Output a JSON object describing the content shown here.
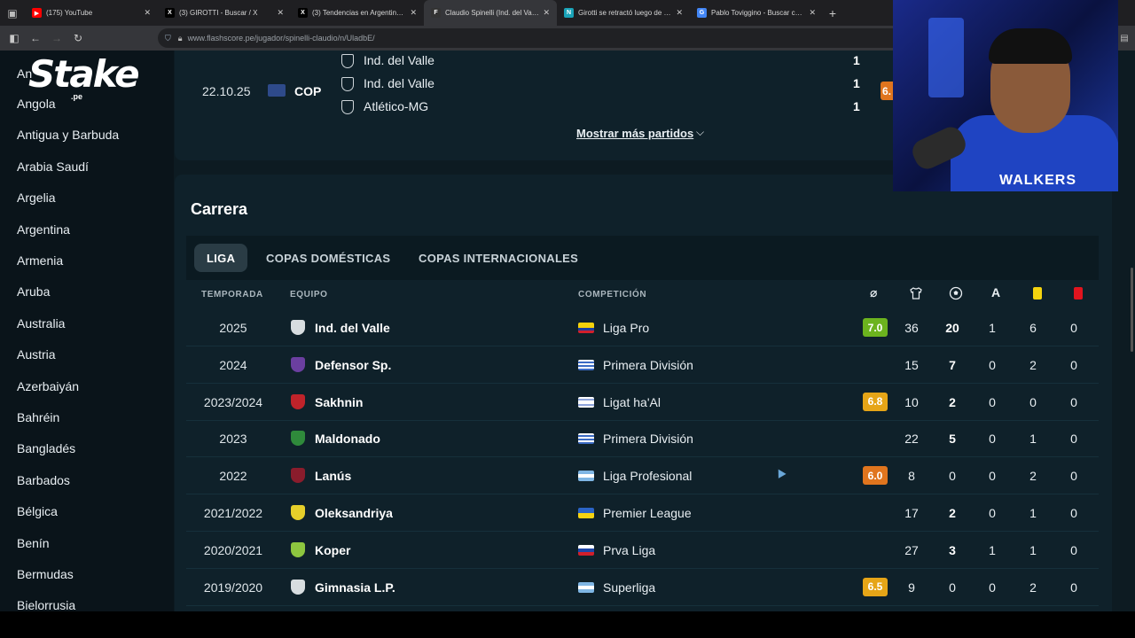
{
  "browser": {
    "tabs": [
      {
        "label": "(175) YouTube",
        "fav_color": "#ff0000",
        "fav_glyph": "▶",
        "active": false
      },
      {
        "label": "(3) GIROTTI - Buscar / X",
        "fav_color": "#000000",
        "fav_glyph": "X",
        "active": false
      },
      {
        "label": "(3) Tendencias en Argentina en",
        "fav_color": "#000000",
        "fav_glyph": "X",
        "active": false
      },
      {
        "label": "Claudio Spinelli (Ind. del Valle) E",
        "fav_color": "#333333",
        "fav_glyph": "F",
        "active": true
      },
      {
        "label": "Girotti se retractó luego de sus",
        "fav_color": "#1aa3b8",
        "fav_glyph": "N",
        "active": false
      },
      {
        "label": "Pablo Toviggino - Buscar con G",
        "fav_color": "#4285f4",
        "fav_glyph": "G",
        "active": false
      }
    ],
    "url": "www.flashscore.pe/jugador/spinelli-claudio/n/UladbE/"
  },
  "sidebar": {
    "countries": [
      "Angola",
      "Antigua y Barbuda",
      "Arabia Saudí",
      "Argelia",
      "Argentina",
      "Armenia",
      "Aruba",
      "Australia",
      "Austria",
      "Azerbaiyán",
      "Bahréin",
      "Bangladés",
      "Barbados",
      "Bélgica",
      "Benín",
      "Bermudas",
      "Bielorrusia"
    ],
    "partial_top": "An",
    "logo_text": "Stake",
    "logo_sub": ".pe"
  },
  "matches": {
    "team_rows": [
      {
        "team": "Ind. del Valle",
        "score": "1"
      },
      {
        "team": "Ind. del Valle",
        "score": "1"
      },
      {
        "team": "Atlético-MG",
        "score": "1"
      }
    ],
    "date": "22.10.25",
    "competition": "COP",
    "rating": "6.",
    "rating_color": "#e0751e",
    "more_label": "Mostrar más partidos"
  },
  "career": {
    "title": "Carrera",
    "tabs": [
      "LIGA",
      "COPAS DOMÉSTICAS",
      "COPAS INTERNACIONALES"
    ],
    "headers": {
      "season": "TEMPORADA",
      "team": "EQUIPO",
      "competition": "COMPETICIÓN",
      "rating_symbol": "⌀"
    },
    "rows": [
      {
        "season": "2025",
        "team": "Ind. del Valle",
        "team_color": "#d8dde0",
        "flag": "ec",
        "competition": "Liga Pro",
        "rating": "7.0",
        "rating_color": "#6cb31e",
        "apps": "36",
        "goals": "20",
        "assists": "1",
        "yellow": "6",
        "red": "0"
      },
      {
        "season": "2024",
        "team": "Defensor Sp.",
        "team_color": "#6b3fa0",
        "flag": "uy",
        "competition": "Primera División",
        "rating": "",
        "rating_color": "",
        "apps": "15",
        "goals": "7",
        "assists": "0",
        "yellow": "2",
        "red": "0"
      },
      {
        "season": "2023/2024",
        "team": "Sakhnin",
        "team_color": "#c0232a",
        "flag": "il",
        "competition": "Ligat ha'Al",
        "rating": "6.8",
        "rating_color": "#e6a517",
        "apps": "10",
        "goals": "2",
        "assists": "0",
        "yellow": "0",
        "red": "0"
      },
      {
        "season": "2023",
        "team": "Maldonado",
        "team_color": "#2f8a3b",
        "flag": "uy",
        "competition": "Primera División",
        "rating": "",
        "rating_color": "",
        "apps": "22",
        "goals": "5",
        "assists": "0",
        "yellow": "1",
        "red": "0"
      },
      {
        "season": "2022",
        "team": "Lanús",
        "team_color": "#8a1c2c",
        "flag": "ar",
        "competition": "Liga Profesional",
        "rating": "6.0",
        "rating_color": "#e0751e",
        "apps": "8",
        "goals": "0",
        "assists": "0",
        "yellow": "2",
        "red": "0"
      },
      {
        "season": "2021/2022",
        "team": "Oleksandriya",
        "team_color": "#e6cf2a",
        "flag": "ua",
        "competition": "Premier League",
        "rating": "",
        "rating_color": "",
        "apps": "17",
        "goals": "2",
        "assists": "0",
        "yellow": "1",
        "red": "0"
      },
      {
        "season": "2020/2021",
        "team": "Koper",
        "team_color": "#8dc63f",
        "flag": "si",
        "competition": "Prva Liga",
        "rating": "",
        "rating_color": "",
        "apps": "27",
        "goals": "3",
        "assists": "1",
        "yellow": "1",
        "red": "0"
      },
      {
        "season": "2019/2020",
        "team": "Gimnasia L.P.",
        "team_color": "#d8dde0",
        "flag": "ar",
        "competition": "Superliga",
        "rating": "6.5",
        "rating_color": "#e6a517",
        "apps": "9",
        "goals": "0",
        "assists": "0",
        "yellow": "2",
        "red": "0"
      }
    ]
  },
  "webcam": {
    "shirt_text": "WALKERS"
  }
}
